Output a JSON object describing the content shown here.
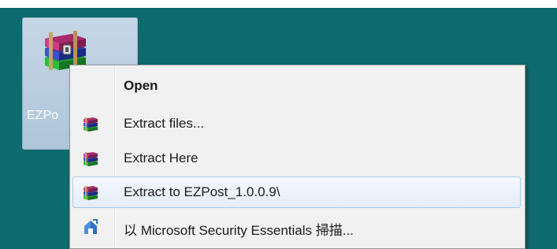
{
  "header": {
    "text": "",
    "link_text": ""
  },
  "desktop": {
    "icon_label": "EZPo",
    "icon_name": "winrar-archive-icon"
  },
  "context_menu": {
    "items": [
      {
        "label": "Open",
        "icon": "",
        "bold": true
      },
      {
        "label": "Extract files...",
        "icon": "winrar-icon"
      },
      {
        "label": "Extract Here",
        "icon": "winrar-icon"
      },
      {
        "label": "Extract to EZPost_1.0.0.9\\",
        "icon": "winrar-icon",
        "highlighted": true
      },
      {
        "label": "以 Microsoft Security Essentials 掃描...",
        "icon": "security-essentials-icon"
      }
    ]
  },
  "colors": {
    "desktop_bg": "#0d6a6d",
    "menu_bg": "#f1f1f1",
    "hover_border": "#a8c8ec",
    "icon_selection": "#b8cde0"
  }
}
